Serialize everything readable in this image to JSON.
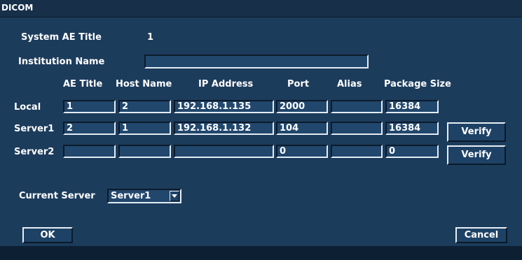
{
  "window": {
    "title": "DICOM"
  },
  "system": {
    "ae_title_label": "System AE Title",
    "ae_title_value": "1",
    "institution_label": "Institution Name",
    "institution_value": ""
  },
  "columns": [
    "AE Title",
    "Host Name",
    "IP Address",
    "Port",
    "Alias",
    "Package Size"
  ],
  "rows": [
    {
      "label": "Local",
      "ae": "1",
      "host": "2",
      "ip": "192.168.1.135",
      "port": "2000",
      "alias": "",
      "size": "16384"
    },
    {
      "label": "Server1",
      "ae": "2",
      "host": "1",
      "ip": "192.168.1.132",
      "port": "104",
      "alias": "",
      "size": "16384",
      "verify": "Verify"
    },
    {
      "label": "Server2",
      "ae": "",
      "host": "",
      "ip": "",
      "port": "0",
      "alias": "",
      "size": "0",
      "verify": "Verify"
    }
  ],
  "current_server": {
    "label": "Current Server",
    "value": "Server1"
  },
  "buttons": {
    "ok": "OK",
    "cancel": "Cancel"
  }
}
